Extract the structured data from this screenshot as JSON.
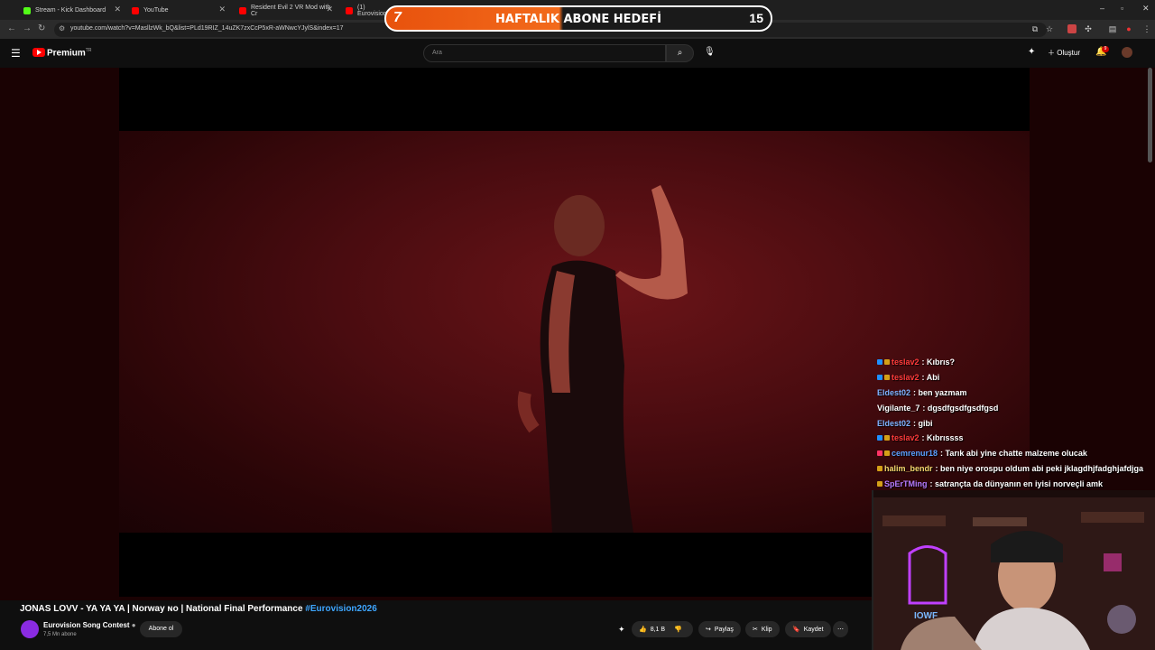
{
  "browser": {
    "tabs": [
      {
        "label": "Stream - Kick Dashboard",
        "color": "#53fc18"
      },
      {
        "label": "YouTube",
        "color": "#ff0000"
      },
      {
        "label": "Resident Evil 2 VR Mod with Cr",
        "color": "#ff0000"
      },
      {
        "label": "(1) Eurovision",
        "color": "#ff0000"
      }
    ],
    "url": "youtube.com/watch?v=MasllzWk_bQ&list=PLd19RIZ_14uZK7zxCcP5xR-aWNwcYJylS&index=17"
  },
  "goal": {
    "current": "7",
    "label": "HAFTALIK ABONE HEDEFİ",
    "target": "15",
    "progress": 0.46
  },
  "youtube": {
    "brand": "Premium",
    "brand_sup": "TR",
    "search_placeholder": "Ara",
    "create_label": "Oluştur",
    "notif_count": "9"
  },
  "chat": [
    {
      "user": "teslav2",
      "text": ": Kıbrıs?",
      "color": "#ff3b3b",
      "badges": [
        "#1e90ff",
        "#d4a017"
      ]
    },
    {
      "user": "teslav2",
      "text": ": Abi",
      "color": "#ff3b3b",
      "badges": [
        "#1e90ff",
        "#d4a017"
      ]
    },
    {
      "user": "Eldest02",
      "text": ": ben yazmam",
      "color": "#7fb2ff",
      "badges": []
    },
    {
      "user": "Vigilante_7",
      "text": ": dgsdfgsdfgsdfgsd",
      "color": "#ffffff",
      "badges": []
    },
    {
      "user": "Eldest02",
      "text": ": gibi",
      "color": "#7fb2ff",
      "badges": []
    },
    {
      "user": "teslav2",
      "text": ": Kıbrıssss",
      "color": "#ff3b3b",
      "badges": [
        "#1e90ff",
        "#d4a017"
      ]
    },
    {
      "user": "cemrenur18",
      "text": ": Tarık abi yine chatte malzeme olucak",
      "color": "#5aa0ff",
      "badges": [
        "#ff3366",
        "#d4a017"
      ]
    },
    {
      "user": "halim_bendr",
      "text": ": ben niye orospu oldum abi peki jklagdhjfadghjafdjga",
      "color": "#f5d76e",
      "badges": [
        "#d4a017"
      ]
    },
    {
      "user": "SpErTMing",
      "text": ": satrançta da dünyanın en iyisi norveçli amk",
      "color": "#b57bff",
      "badges": [
        "#d4a017"
      ]
    }
  ],
  "video": {
    "title": "JONAS LOVV - YA YA YA | Norway ɴᴏ | National Final Performance",
    "hashtag": "#Eurovision2026",
    "channel": "Eurovision Song Contest",
    "subscribers": "7,5 Mn abone",
    "subscribe_label": "Abone ol",
    "likes": "8,1 B",
    "share_label": "Paylaş",
    "clip_label": "Klip",
    "save_label": "Kaydet"
  }
}
